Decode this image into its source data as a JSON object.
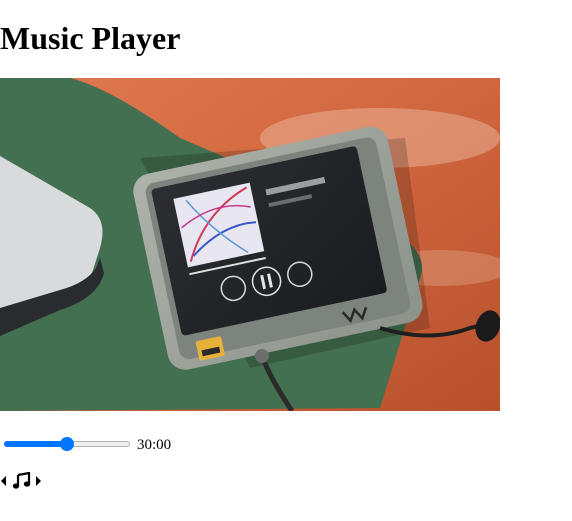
{
  "page": {
    "title": "Music Player"
  },
  "cover": {
    "icon": "album-cover-image",
    "alt": "Walkman music player photo"
  },
  "player": {
    "time_display": "30:00",
    "progress_fraction": 0.5,
    "accent_color": "#0075ff"
  },
  "controls": {
    "prev_icon": "caret-left-icon",
    "play_icon": "music-note-icon",
    "next_icon": "caret-right-icon"
  }
}
